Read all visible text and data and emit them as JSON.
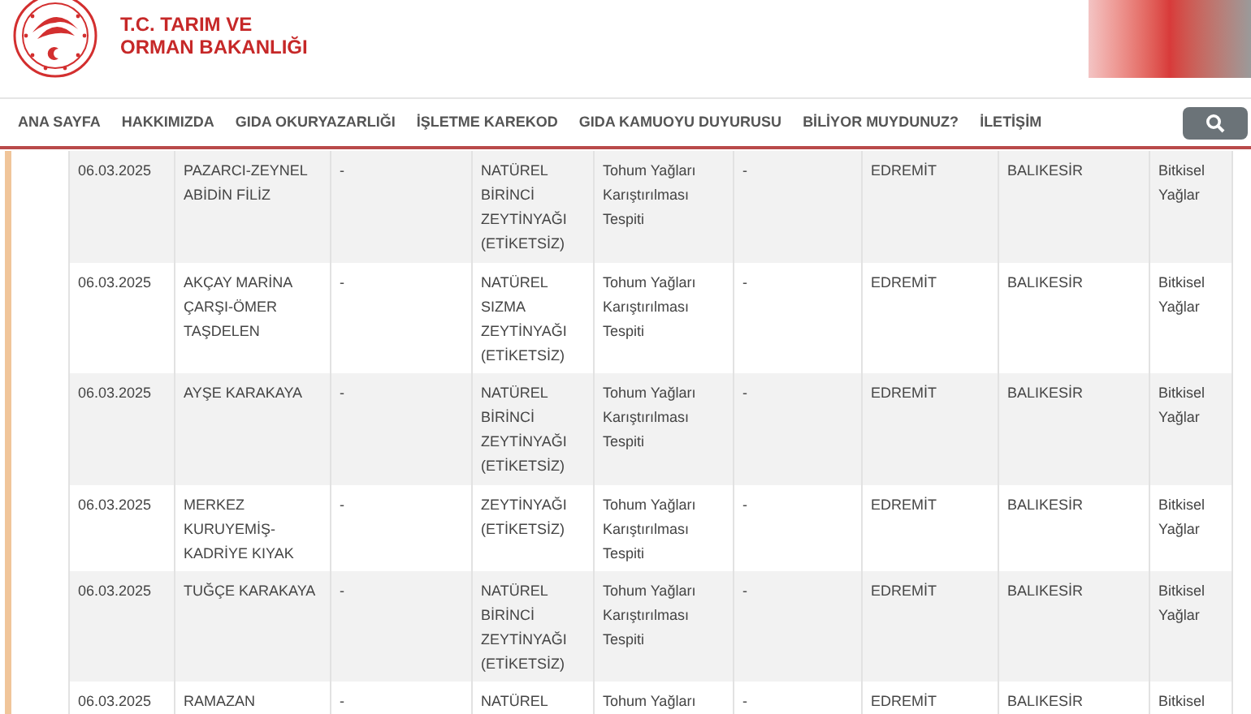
{
  "header": {
    "title_line_1": "T.C. TARIM VE",
    "title_line_2": "ORMAN BAKANLIĞI"
  },
  "nav": {
    "items": [
      {
        "label": "ANA SAYFA"
      },
      {
        "label": "HAKKIMIZDA"
      },
      {
        "label": "GIDA OKURYAZARLIĞI"
      },
      {
        "label": "İŞLETME KAREKOD"
      },
      {
        "label": "GIDA KAMUOYU DUYURUSU"
      },
      {
        "label": "BİLİYOR MUYDUNUZ?"
      },
      {
        "label": "İLETİŞİM"
      }
    ]
  },
  "table": {
    "rows": [
      {
        "cells": [
          "06.03.2025",
          "PAZARCI-ZEYNEL ABİDİN FİLİZ",
          "-",
          "NATÜREL BİRİNCİ ZEYTİNYAĞI (ETİKETSİZ)",
          "Tohum Yağları Karıştırılması Tespiti",
          "-",
          "EDREMİT",
          "BALIKESİR",
          "Bitkisel Yağlar"
        ]
      },
      {
        "cells": [
          "06.03.2025",
          "AKÇAY MARİNA ÇARŞI-ÖMER TAŞDELEN",
          "-",
          "NATÜREL SIZMA ZEYTİNYAĞI (ETİKETSİZ)",
          "Tohum Yağları Karıştırılması Tespiti",
          "-",
          "EDREMİT",
          "BALIKESİR",
          "Bitkisel Yağlar"
        ]
      },
      {
        "cells": [
          "06.03.2025",
          "AYŞE KARAKAYA",
          "-",
          "NATÜREL BİRİNCİ ZEYTİNYAĞI (ETİKETSİZ)",
          "Tohum Yağları Karıştırılması Tespiti",
          "-",
          "EDREMİT",
          "BALIKESİR",
          "Bitkisel Yağlar"
        ]
      },
      {
        "cells": [
          "06.03.2025",
          "MERKEZ KURUYEMİŞ-KADRİYE KIYAK",
          "-",
          "ZEYTİNYAĞI (ETİKETSİZ)",
          "Tohum Yağları Karıştırılması Tespiti",
          "-",
          "EDREMİT",
          "BALIKESİR",
          "Bitkisel Yağlar"
        ]
      },
      {
        "cells": [
          "06.03.2025",
          "TUĞÇE KARAKAYA",
          "-",
          "NATÜREL BİRİNCİ ZEYTİNYAĞI (ETİKETSİZ)",
          "Tohum Yağları Karıştırılması Tespiti",
          "-",
          "EDREMİT",
          "BALIKESİR",
          "Bitkisel Yağlar"
        ]
      },
      {
        "cells": [
          "06.03.2025",
          "RAMAZAN",
          "-",
          "NATÜREL",
          "Tohum Yağları",
          "-",
          "EDREMİT",
          "BALIKESİR",
          "Bitkisel"
        ]
      }
    ]
  }
}
